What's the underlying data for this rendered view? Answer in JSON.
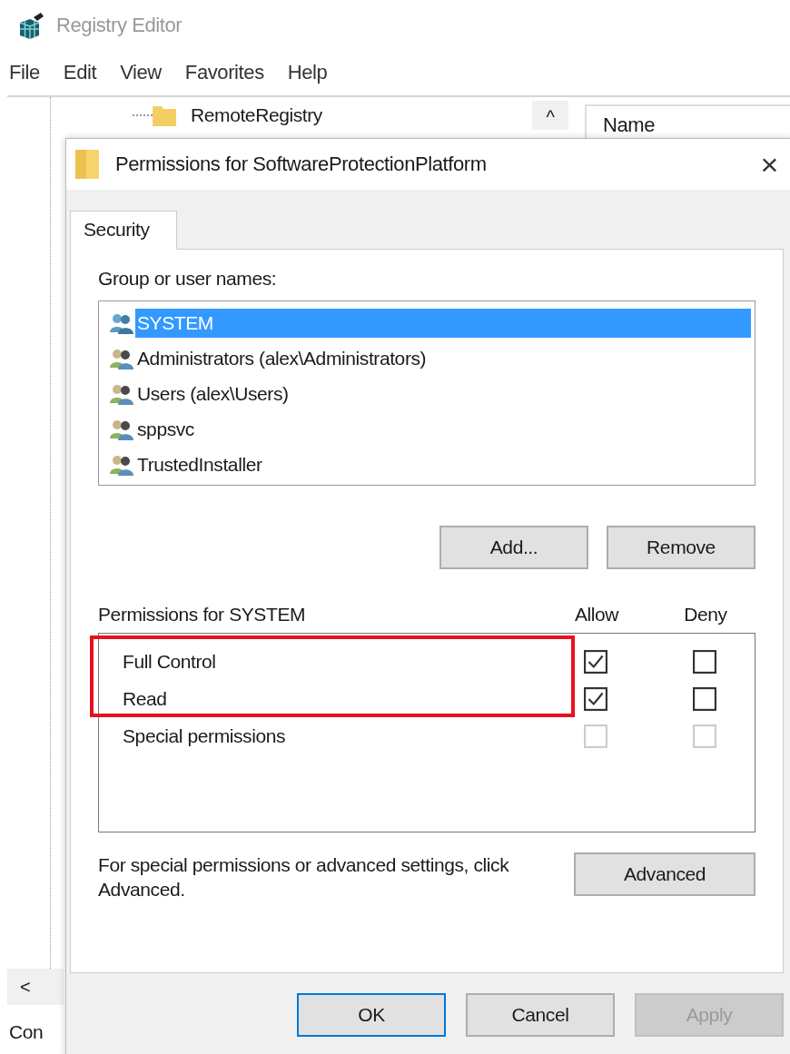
{
  "editor": {
    "title": "Registry Editor",
    "menu": [
      "File",
      "Edit",
      "View",
      "Favorites",
      "Help"
    ],
    "tree_item": "RemoteRegistry",
    "scroll_up": "^",
    "column_header": "Name",
    "scroll_left": "<",
    "status": "Con"
  },
  "dialog": {
    "title": "Permissions for SoftwareProtectionPlatform",
    "close": "×",
    "tabs": [
      {
        "label": "Security",
        "selected": true
      }
    ],
    "group_label": "Group or user names:",
    "users": [
      {
        "name": "SYSTEM",
        "selected": true
      },
      {
        "name": "Administrators (alex\\Administrators)",
        "selected": false
      },
      {
        "name": "Users (alex\\Users)",
        "selected": false
      },
      {
        "name": "sppsvc",
        "selected": false
      },
      {
        "name": "TrustedInstaller",
        "selected": false
      }
    ],
    "add": "Add...",
    "remove": "Remove",
    "perm_label": "Permissions for SYSTEM",
    "allow": "Allow",
    "deny": "Deny",
    "permissions": [
      {
        "name": "Full Control",
        "allow": true,
        "deny": false,
        "disabled": false,
        "highlighted": true
      },
      {
        "name": "Read",
        "allow": true,
        "deny": false,
        "disabled": false,
        "highlighted": true
      },
      {
        "name": "Special permissions",
        "allow": false,
        "deny": false,
        "disabled": true,
        "highlighted": false
      }
    ],
    "advanced_note": "For special permissions or advanced settings, click Advanced.",
    "advanced": "Advanced",
    "buttons": [
      {
        "label": "OK",
        "kind": "default"
      },
      {
        "label": "Cancel",
        "kind": "normal"
      },
      {
        "label": "Apply",
        "kind": "disabled"
      }
    ]
  }
}
